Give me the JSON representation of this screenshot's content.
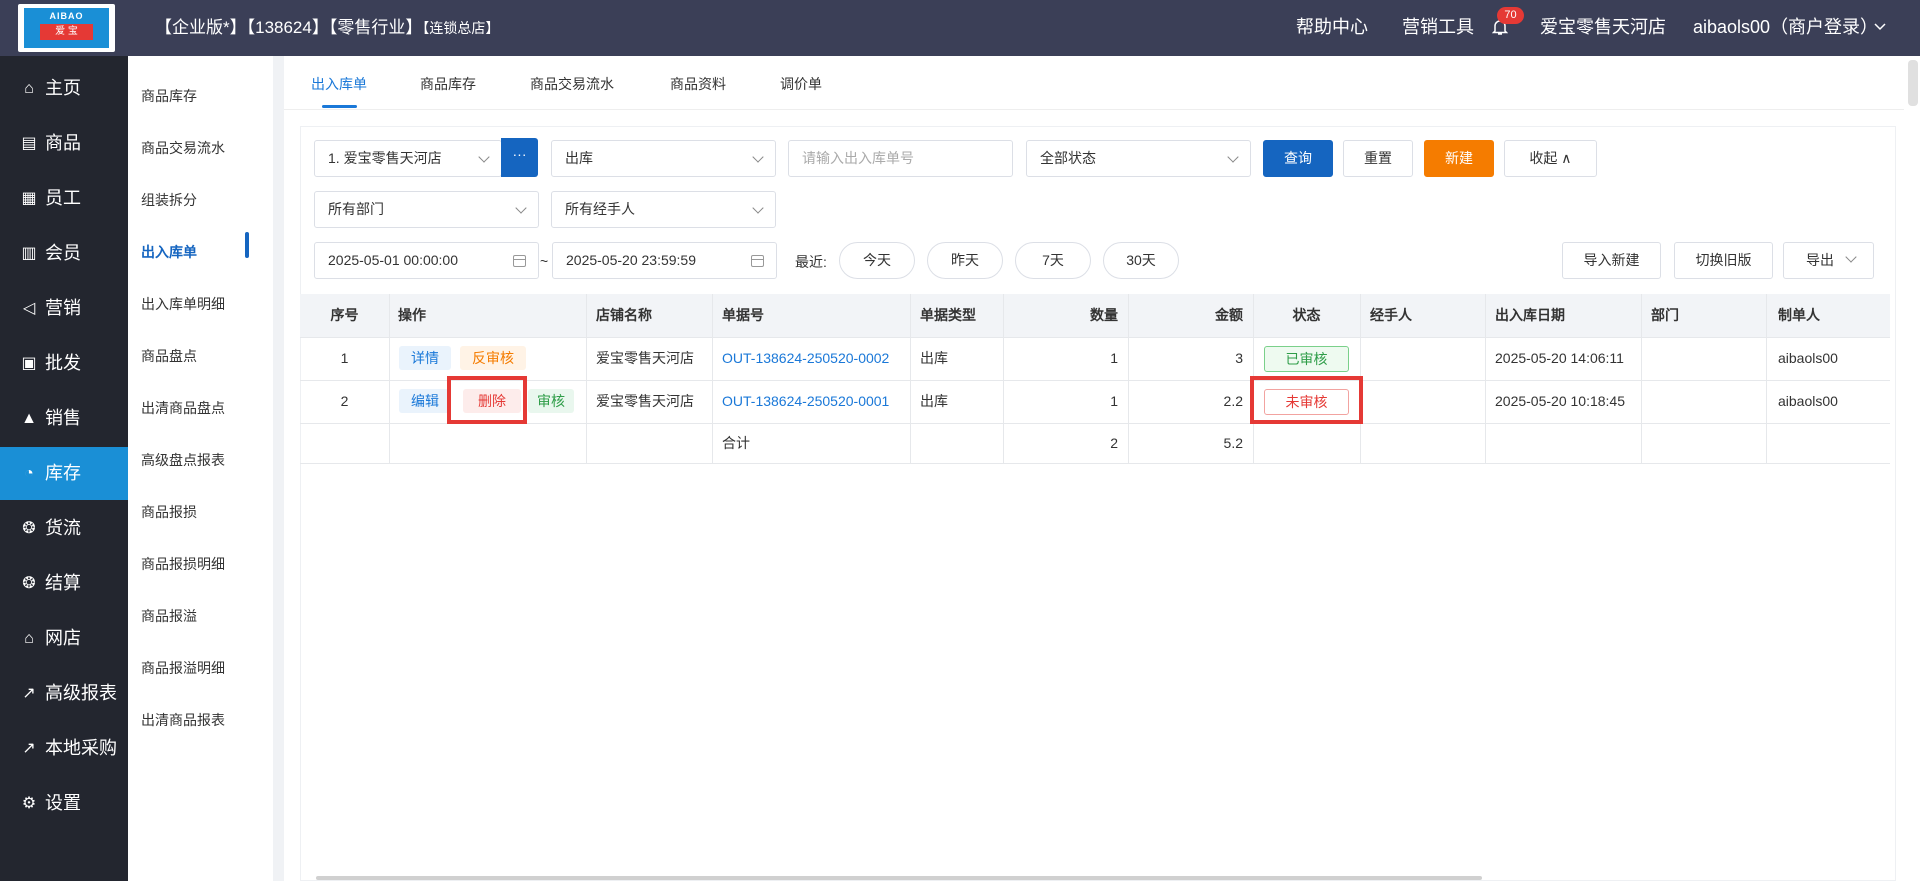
{
  "header": {
    "logo_top": "AIBAO",
    "logo_mid": "爱 宝",
    "title_main": "【企业版*】【138624】【零售行业】",
    "title_sub": "【连锁总店",
    "title_close": "】",
    "help": "帮助中心",
    "marketing": "营销工具",
    "notify_count": "70",
    "store": "爱宝零售天河店",
    "user": "aibaols00（商户登录）"
  },
  "sidebar": {
    "items": [
      {
        "label": "主页",
        "icon": "⌂"
      },
      {
        "label": "商品",
        "icon": "▤"
      },
      {
        "label": "员工",
        "icon": "▦"
      },
      {
        "label": "会员",
        "icon": "▥"
      },
      {
        "label": "营销",
        "icon": "◁"
      },
      {
        "label": "批发",
        "icon": "▣"
      },
      {
        "label": "销售",
        "icon": "▲"
      },
      {
        "label": "库存",
        "icon": "◔"
      },
      {
        "label": "货流",
        "icon": "❂"
      },
      {
        "label": "结算",
        "icon": "❂"
      },
      {
        "label": "网店",
        "icon": "⌂"
      },
      {
        "label": "高级报表",
        "icon": "↗"
      },
      {
        "label": "本地采购",
        "icon": "↗"
      },
      {
        "label": "设置",
        "icon": "⚙"
      }
    ]
  },
  "submenu": {
    "items": [
      "商品库存",
      "商品交易流水",
      "组装拆分",
      "出入库单",
      "出入库单明细",
      "商品盘点",
      "出清商品盘点",
      "高级盘点报表",
      "商品报损",
      "商品报损明细",
      "商品报溢",
      "商品报溢明细",
      "出清商品报表"
    ]
  },
  "tabs": [
    "出入库单",
    "商品库存",
    "商品交易流水",
    "商品资料",
    "调价单"
  ],
  "filters": {
    "store": "1. 爱宝零售天河店",
    "dots": "···",
    "type": "出库",
    "bill_placeholder": "请输入出入库单号",
    "status": "全部状态",
    "query": "查询",
    "reset": "重置",
    "new": "新建",
    "collapse": "收起 ∧",
    "department": "所有部门",
    "handler": "所有经手人",
    "date_from": "2025-05-01 00:00:00",
    "date_sep": "~",
    "date_to": "2025-05-20 23:59:59",
    "recent_label": "最近:",
    "recent": [
      "今天",
      "昨天",
      "7天",
      "30天"
    ],
    "import_new": "导入新建",
    "switch_old": "切换旧版",
    "export": "导出"
  },
  "table": {
    "headers": [
      "序号",
      "操作",
      "店铺名称",
      "单据号",
      "单据类型",
      "数量",
      "金额",
      "状态",
      "经手人",
      "出入库日期",
      "部门",
      "制单人"
    ],
    "rows": [
      {
        "no": "1",
        "actions": [
          "详情",
          "反审核"
        ],
        "store": "爱宝零售天河店",
        "bill": "OUT-138624-250520-0002",
        "type": "出库",
        "qty": "1",
        "amount": "3",
        "status": "已审核",
        "handler": "",
        "date": "2025-05-20 14:06:11",
        "dept": "",
        "maker": "aibaols00"
      },
      {
        "no": "2",
        "actions": [
          "编辑",
          "删除",
          "审核"
        ],
        "store": "爱宝零售天河店",
        "bill": "OUT-138624-250520-0001",
        "type": "出库",
        "qty": "1",
        "amount": "2.2",
        "status": "未审核",
        "handler": "",
        "date": "2025-05-20 10:18:45",
        "dept": "",
        "maker": "aibaols00"
      }
    ],
    "total": {
      "label": "合计",
      "qty": "2",
      "amount": "5.2"
    }
  },
  "colors": {
    "topbar": "#3b3f57",
    "sidebar": "#23262f",
    "active": "#1a8fd6",
    "primary": "#1565c0",
    "orange": "#f57c00",
    "highlight": "#e53935"
  }
}
